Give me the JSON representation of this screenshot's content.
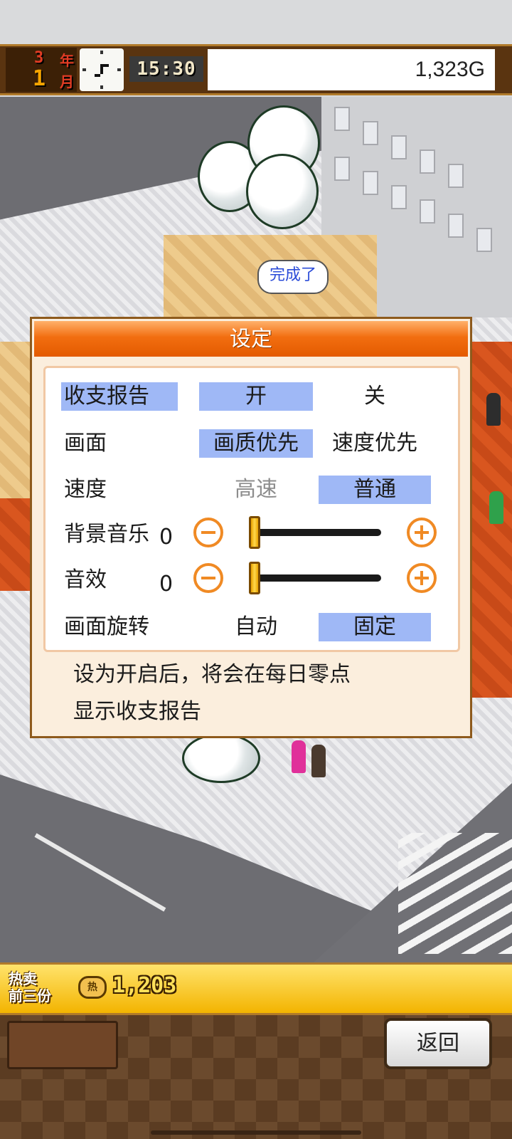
{
  "hud": {
    "year_number": "3",
    "year_unit": "年",
    "month_number": "1",
    "month_unit": "月",
    "time": "15:30",
    "money": "1,323G"
  },
  "world": {
    "speech_bubble": "完成了"
  },
  "settings_dialog": {
    "title": "设定",
    "rows": {
      "report": {
        "label": "收支报告",
        "on": "开",
        "off": "关",
        "selected": "开"
      },
      "display": {
        "label": "画面",
        "quality": "画质优先",
        "speed": "速度优先",
        "selected": "画质优先"
      },
      "speed": {
        "label": "速度",
        "fast": "高速",
        "normal": "普通",
        "selected": "普通"
      },
      "bgm": {
        "label": "背景音乐",
        "value": "0",
        "level": 0
      },
      "sfx": {
        "label": "音效",
        "value": "0",
        "level": 0
      },
      "rotation": {
        "label": "画面旋转",
        "auto": "自动",
        "fixed": "固定",
        "selected": "固定"
      }
    },
    "description_line1": "设为开启后，将会在每日零点",
    "description_line2": "显示收支报告"
  },
  "bottom_hud": {
    "hot_label_line1": "热卖",
    "hot_label_line2": "前三份",
    "hot_icon_label": "热",
    "hot_value": "1,203",
    "back_button": "返回"
  },
  "colors": {
    "selected_option": "#9fb8f6",
    "dialog_header": "#f26e10",
    "accent_orange": "#f08a24"
  }
}
